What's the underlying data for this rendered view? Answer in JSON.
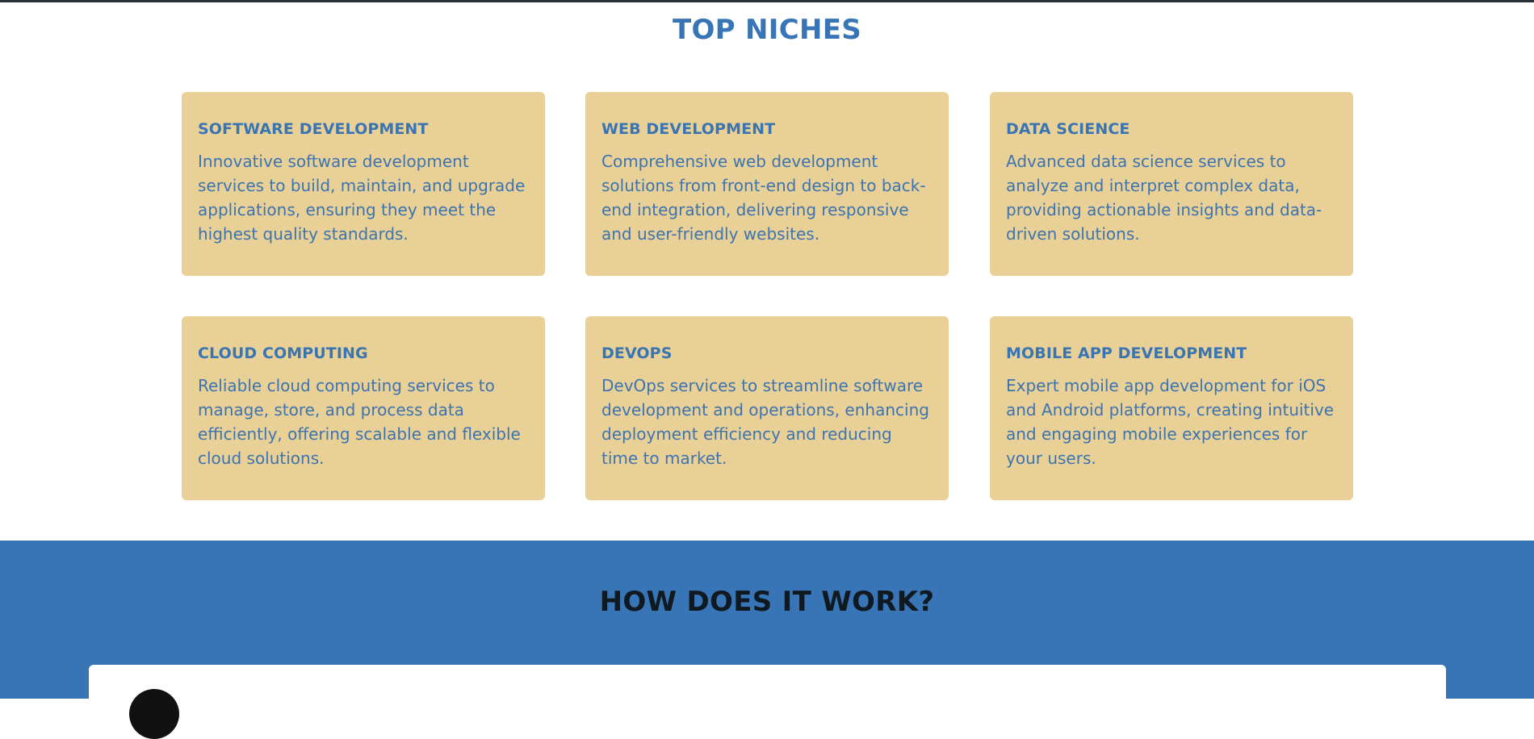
{
  "top_niches": {
    "title": "TOP NICHES",
    "cards": [
      {
        "title": "SOFTWARE DEVELOPMENT",
        "description": "Innovative software development services to build, maintain, and upgrade applications, ensuring they meet the highest quality standards."
      },
      {
        "title": "WEB DEVELOPMENT",
        "description": "Comprehensive web development solutions from front-end design to back-end integration, delivering responsive and user-friendly websites."
      },
      {
        "title": "DATA SCIENCE",
        "description": "Advanced data science services to analyze and interpret complex data, providing actionable insights and data-driven solutions."
      },
      {
        "title": "CLOUD COMPUTING",
        "description": "Reliable cloud computing services to manage, store, and process data efficiently, offering scalable and flexible cloud solutions."
      },
      {
        "title": "DEVOPS",
        "description": "DevOps services to streamline software development and operations, enhancing deployment efficiency and reducing time to market."
      },
      {
        "title": "MOBILE APP DEVELOPMENT",
        "description": "Expert mobile app development for iOS and Android platforms, creating intuitive and engaging mobile experiences for your users."
      }
    ]
  },
  "how_it_works": {
    "title": "HOW DOES IT WORK?"
  },
  "colors": {
    "accent_blue": "#3775b7",
    "card_background": "#e8d096",
    "heading_dark": "#101820"
  }
}
